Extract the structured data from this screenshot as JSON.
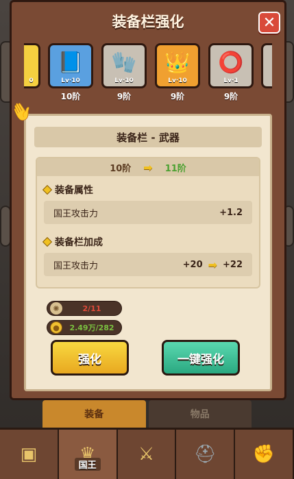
{
  "modal": {
    "title": "装备栏强化",
    "close": "✕"
  },
  "slots": [
    {
      "level": "Lv·10",
      "tier": "10阶",
      "icon": "📘",
      "color": "blue",
      "icon_name": "tome-icon"
    },
    {
      "level": "Lv·10",
      "tier": "9阶",
      "icon": "🧤",
      "color": "gray",
      "icon_name": "glove-icon"
    },
    {
      "level": "Lv·10",
      "tier": "9阶",
      "icon": "👑",
      "color": "orange",
      "icon_name": "crown-icon"
    },
    {
      "level": "Lv·1",
      "tier": "9阶",
      "icon": "⭕",
      "color": "gray",
      "icon_name": "ring-icon"
    }
  ],
  "partial_slot_level": "0",
  "panel": {
    "header": "装备栏 - 武器",
    "tier_from": "10阶",
    "tier_to": "11阶",
    "equip_attr_title": "装备属性",
    "equip_attr_label": "国王攻击力",
    "equip_attr_value": "+1.2",
    "slot_bonus_title": "装备栏加成",
    "slot_bonus_label": "国王攻击力",
    "slot_bonus_from": "+20",
    "slot_bonus_to": "+22",
    "stone_cost": "2/11",
    "coin_cost": "2.49万/282",
    "enhance_button": "强化",
    "enhance_all_button": "一键强化"
  },
  "sub_tabs": {
    "equip": "装备",
    "items": "物品"
  },
  "nav": {
    "king_label": "国王"
  },
  "colors": {
    "accent_yellow": "#f0c020",
    "green": "#4aa030",
    "red": "#e04a3a"
  }
}
